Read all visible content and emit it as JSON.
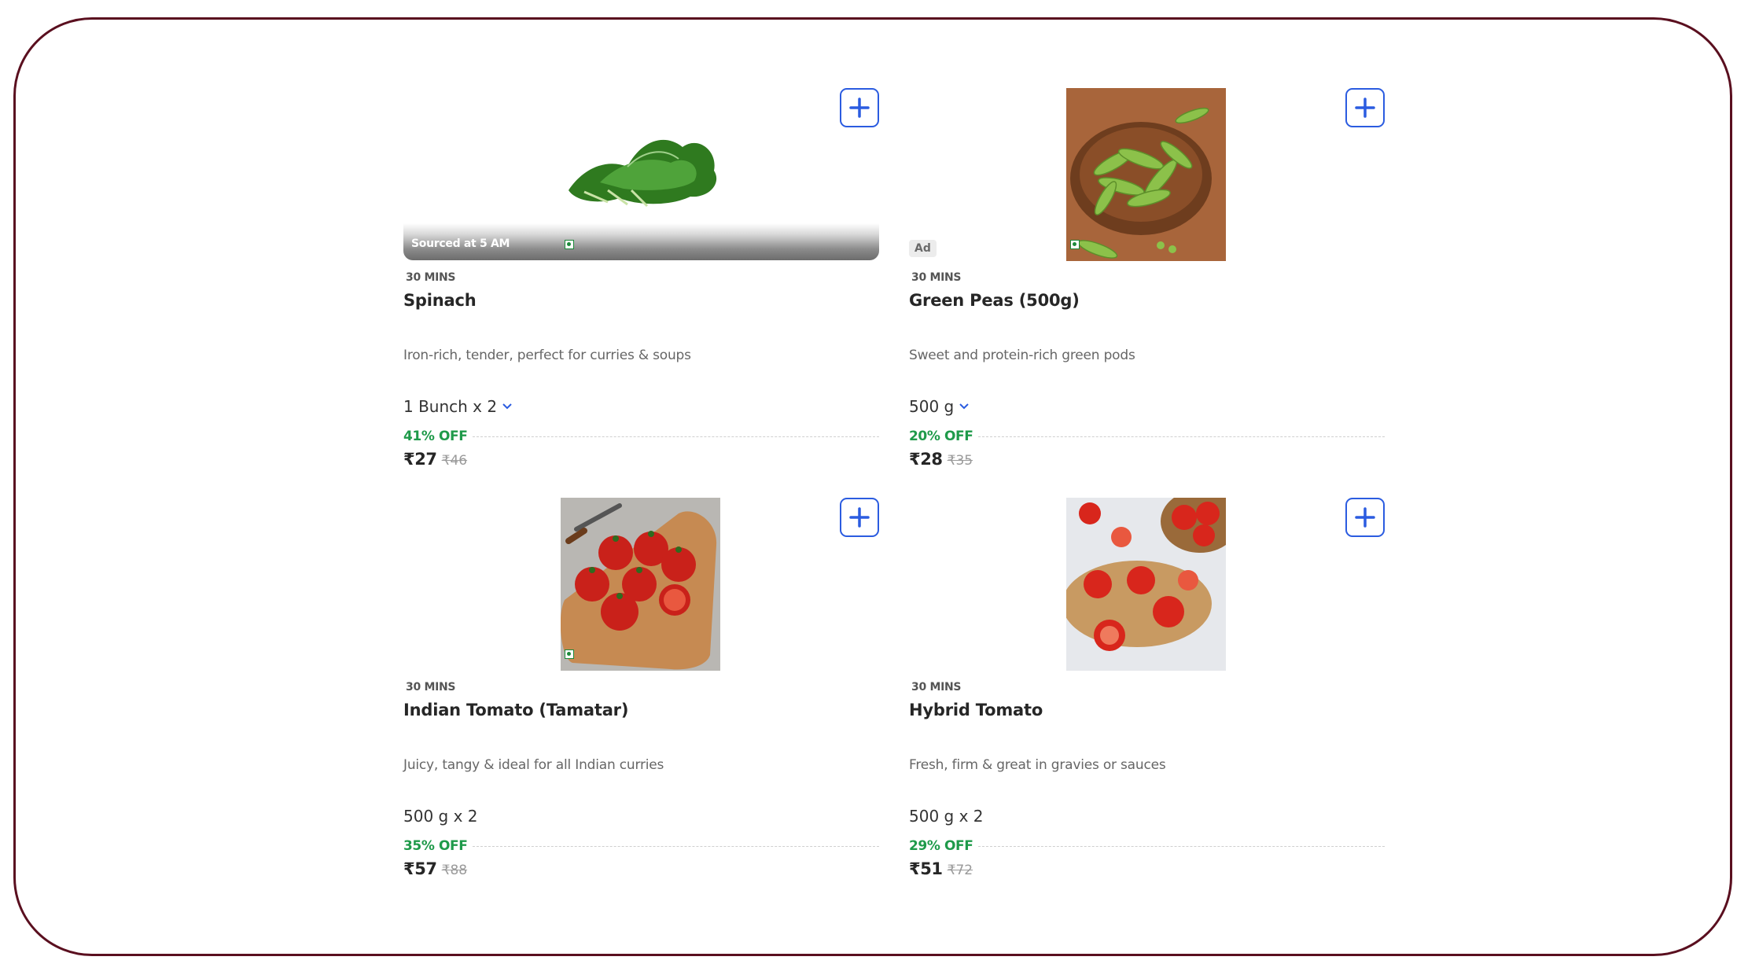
{
  "products": [
    {
      "name": "Spinach",
      "eta": "30 MINS",
      "description": "Iron-rich, tender, perfect for curries & soups",
      "quantity": "1 Bunch x 2",
      "has_quantity_dropdown": true,
      "discount": "41% OFF",
      "price": "₹27",
      "mrp": "₹46",
      "badge": "Sourced at 5 AM",
      "ad": null
    },
    {
      "name": "Green Peas (500g)",
      "eta": "30 MINS",
      "description": "Sweet and protein-rich green pods",
      "quantity": "500 g",
      "has_quantity_dropdown": true,
      "discount": "20% OFF",
      "price": "₹28",
      "mrp": "₹35",
      "badge": null,
      "ad": "Ad"
    },
    {
      "name": "Indian Tomato (Tamatar)",
      "eta": "30 MINS",
      "description": "Juicy, tangy & ideal for all Indian curries",
      "quantity": "500 g x 2",
      "has_quantity_dropdown": false,
      "discount": "35% OFF",
      "price": "₹57",
      "mrp": "₹88",
      "badge": null,
      "ad": null
    },
    {
      "name": "Hybrid Tomato",
      "eta": "30 MINS",
      "description": "Fresh, firm & great in gravies or sauces",
      "quantity": "500 g x 2",
      "has_quantity_dropdown": false,
      "discount": "29% OFF",
      "price": "₹51",
      "mrp": "₹72",
      "badge": null,
      "ad": null
    }
  ],
  "colors": {
    "frame_border": "#5a0f1f",
    "add_button": "#2b5ce0",
    "discount": "#1f9a4a",
    "veg_indicator": "#1c8a3a"
  },
  "icons": {
    "add": "plus-icon",
    "dropdown": "chevron-down-icon",
    "veg": "veg-indicator-icon"
  }
}
